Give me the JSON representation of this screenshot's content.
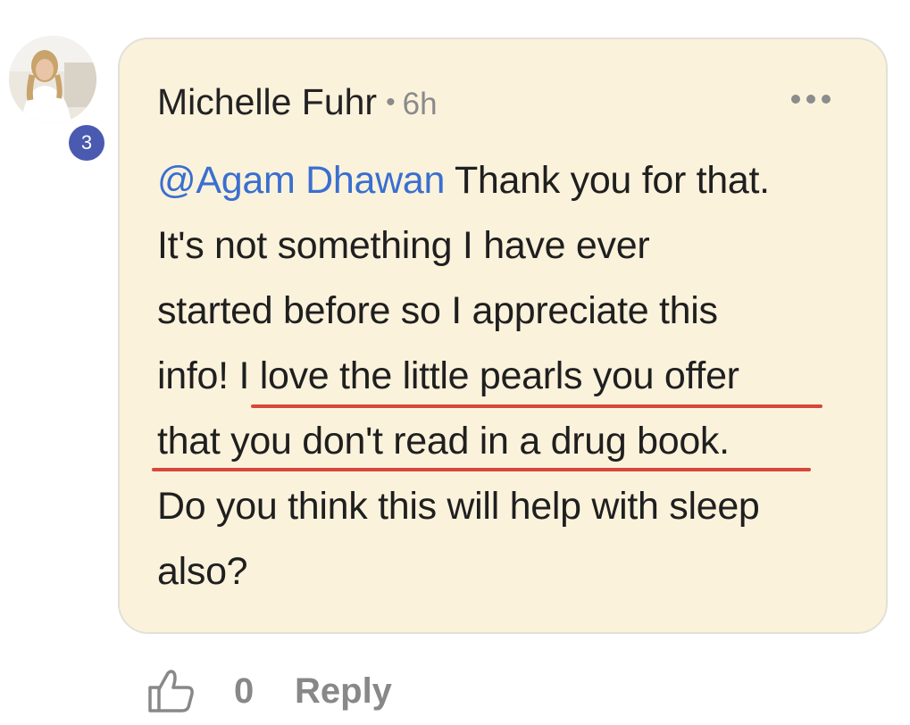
{
  "comment": {
    "author": "Michelle Fuhr",
    "separator": "•",
    "time": "6h",
    "badge_count": "3",
    "mention": "@Agam Dhawan",
    "lines": [
      " Thank you for that.",
      "It's not something I have ever",
      "started before so I appreciate this",
      "info! ",
      "I love the little pearls you offer",
      "that you don't read in a drug book.",
      "Do you think this will help with sleep",
      "also?"
    ],
    "likes": "0",
    "reply_label": "Reply"
  },
  "colors": {
    "bubble_bg": "#fbf2dc",
    "mention": "#3a6fd0",
    "underline": "#d8473a",
    "badge": "#4a5ab0",
    "muted": "#888888"
  },
  "icons": {
    "more": "more-horizontal-icon",
    "like": "thumbs-up-icon"
  }
}
